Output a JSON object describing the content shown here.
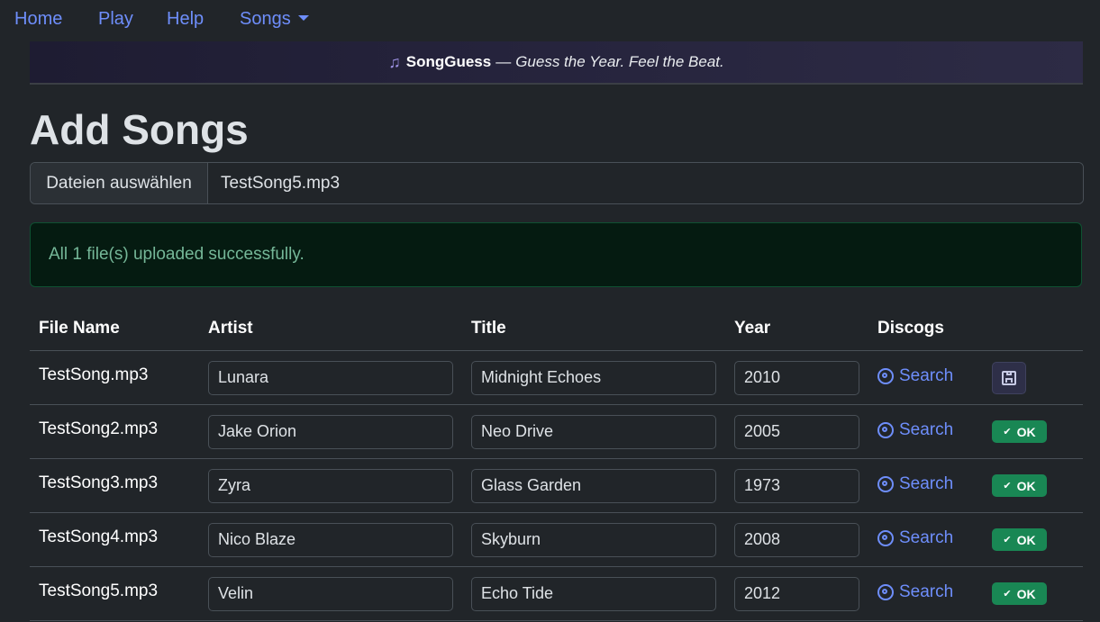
{
  "nav": {
    "items": [
      {
        "label": "Home"
      },
      {
        "label": "Play"
      },
      {
        "label": "Help"
      },
      {
        "label": "Songs"
      }
    ]
  },
  "banner": {
    "icon": "music-note-icon",
    "brand": "SongGuess",
    "separator": "—",
    "tagline": "Guess the Year. Feel the Beat."
  },
  "page": {
    "title": "Add Songs"
  },
  "file_input": {
    "button_label": "Dateien auswählen",
    "selected_file": "TestSong5.mp3"
  },
  "alert": {
    "message": "All 1 file(s) uploaded successfully."
  },
  "table": {
    "headers": [
      "File Name",
      "Artist",
      "Title",
      "Year",
      "Discogs"
    ],
    "rows": [
      {
        "file": "TestSong.mp3",
        "artist": "Lunara",
        "title": "Midnight Echoes",
        "year": "2010",
        "search": "Search",
        "status": "save"
      },
      {
        "file": "TestSong2.mp3",
        "artist": "Jake Orion",
        "title": "Neo Drive",
        "year": "2005",
        "search": "Search",
        "status": "OK"
      },
      {
        "file": "TestSong3.mp3",
        "artist": "Zyra",
        "title": "Glass Garden",
        "year": "1973",
        "search": "Search",
        "status": "OK"
      },
      {
        "file": "TestSong4.mp3",
        "artist": "Nico Blaze",
        "title": "Skyburn",
        "year": "2008",
        "search": "Search",
        "status": "OK"
      },
      {
        "file": "TestSong5.mp3",
        "artist": "Velin",
        "title": "Echo Tide",
        "year": "2012",
        "search": "Search",
        "status": "OK"
      }
    ]
  },
  "colors": {
    "background": "#212529",
    "link": "#6e8efb",
    "success_bg": "#198754",
    "alert_bg": "#051b11",
    "alert_text": "#75b798"
  }
}
